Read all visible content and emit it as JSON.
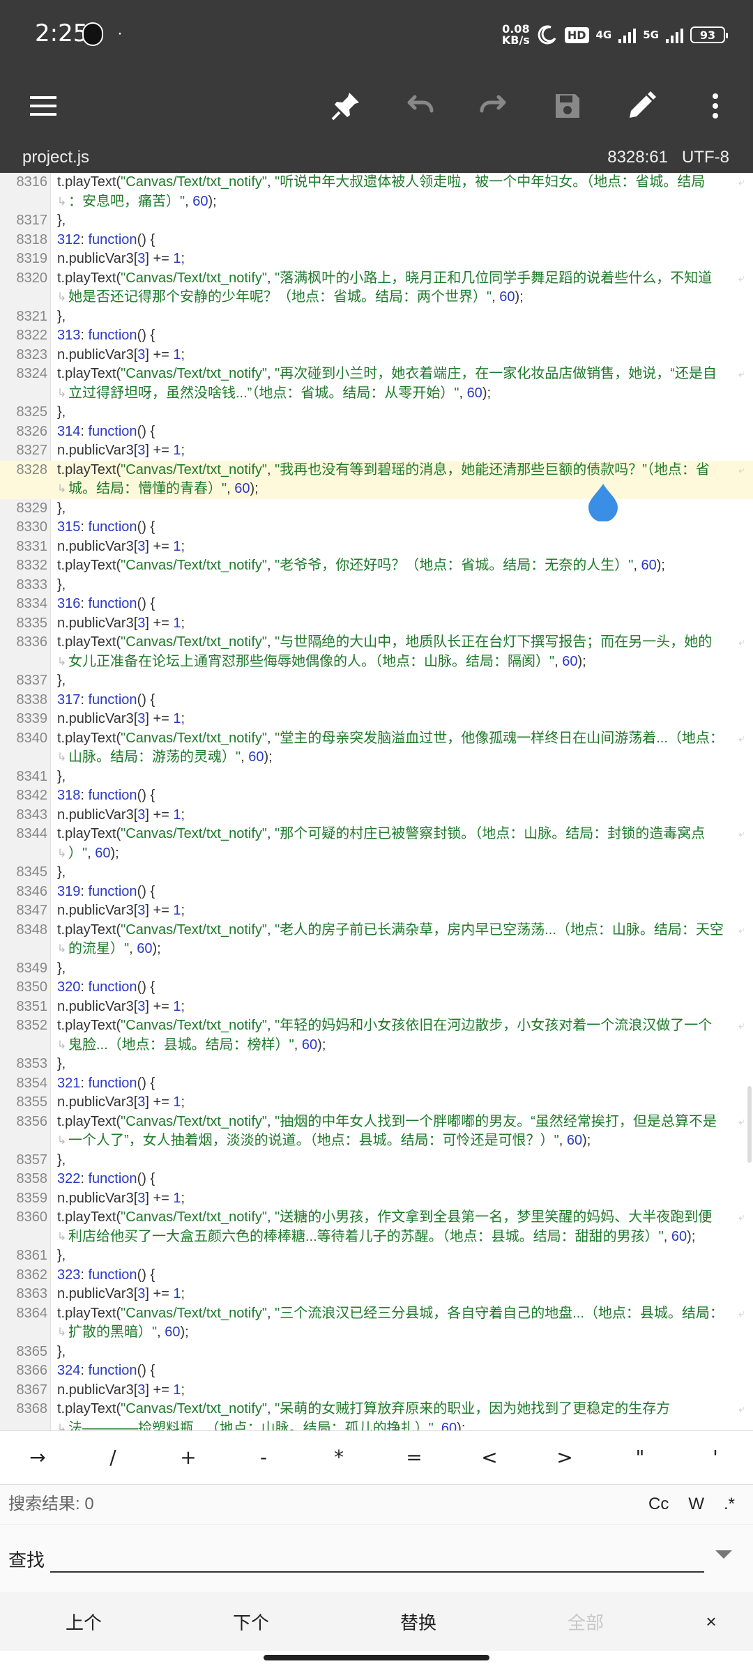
{
  "status": {
    "time": "2:25",
    "dot": "·",
    "speed_value": "0.08",
    "speed_unit": "KB/s",
    "hd": "HD",
    "net1": "4G",
    "net2": "5G",
    "battery": "93"
  },
  "toolbar": {
    "icons": [
      "menu-icon",
      "pin-icon",
      "undo-icon",
      "redo-icon",
      "save-icon",
      "edit-icon",
      "more-icon"
    ]
  },
  "file": {
    "name": "project.js",
    "position": "8328:61",
    "encoding": "UTF-8"
  },
  "lines": [
    {
      "n": "8316",
      "t": "call",
      "text": "\"听说中年大叔遗体被人领走啦，被一个中年妇女。（地点：省城。结局",
      "cont": "：安息吧，痛苦）\""
    },
    {
      "n": "8317",
      "t": "close"
    },
    {
      "n": "8318",
      "t": "fn",
      "id": "312"
    },
    {
      "n": "8319",
      "t": "inc"
    },
    {
      "n": "8320",
      "t": "call",
      "text": "\"落满枫叶的小路上，晓月正和几位同学手舞足蹈的说着些什么，不知道",
      "cont": "她是否还记得那个安静的少年呢？（地点：省城。结局：两个世界）\""
    },
    {
      "n": "8321",
      "t": "close"
    },
    {
      "n": "8322",
      "t": "fn",
      "id": "313"
    },
    {
      "n": "8323",
      "t": "inc"
    },
    {
      "n": "8324",
      "t": "call",
      "text": "\"再次碰到小兰时，她衣着端庄，在一家化妆品店做销售，她说，“还是自",
      "cont": "立过得舒坦呀，虽然没啥钱...”（地点：省城。结局：从零开始）\""
    },
    {
      "n": "8325",
      "t": "close"
    },
    {
      "n": "8326",
      "t": "fn",
      "id": "314"
    },
    {
      "n": "8327",
      "t": "inc"
    },
    {
      "n": "8328",
      "t": "call",
      "hl": true,
      "text": "\"我再也没有等到碧瑶的消息，她能还清那些巨额的债款吗？”（地点：省",
      "cont": "城。结局：懵懂的青春）\""
    },
    {
      "n": "8329",
      "t": "close"
    },
    {
      "n": "8330",
      "t": "fn",
      "id": "315"
    },
    {
      "n": "8331",
      "t": "inc"
    },
    {
      "n": "8332",
      "t": "call1",
      "text": "\"老爷爷，你还好吗？（地点：省城。结局：无奈的人生）\""
    },
    {
      "n": "8333",
      "t": "close"
    },
    {
      "n": "8334",
      "t": "fn",
      "id": "316"
    },
    {
      "n": "8335",
      "t": "inc"
    },
    {
      "n": "8336",
      "t": "call",
      "text": "\"与世隔绝的大山中，地质队长正在台灯下撰写报告；而在另一头，她的",
      "cont": "女儿正准备在论坛上通宵怼那些侮辱她偶像的人。（地点：山脉。结局：隔阂）\""
    },
    {
      "n": "8337",
      "t": "close"
    },
    {
      "n": "8338",
      "t": "fn",
      "id": "317"
    },
    {
      "n": "8339",
      "t": "inc"
    },
    {
      "n": "8340",
      "t": "call",
      "text": "\"堂主的母亲突发脑溢血过世，他像孤魂一样终日在山间游荡着...（地点：",
      "cont": "山脉。结局：游荡的灵魂）\""
    },
    {
      "n": "8341",
      "t": "close"
    },
    {
      "n": "8342",
      "t": "fn",
      "id": "318"
    },
    {
      "n": "8343",
      "t": "inc"
    },
    {
      "n": "8344",
      "t": "call",
      "text": "\"那个可疑的村庄已被警察封锁。（地点：山脉。结局：封锁的造毒窝点",
      "cont": "）\""
    },
    {
      "n": "8345",
      "t": "close"
    },
    {
      "n": "8346",
      "t": "fn",
      "id": "319"
    },
    {
      "n": "8347",
      "t": "inc"
    },
    {
      "n": "8348",
      "t": "call",
      "text": "\"老人的房子前已长满杂草，房内早已空荡荡...（地点：山脉。结局：天空",
      "cont": "的流星）\""
    },
    {
      "n": "8349",
      "t": "close"
    },
    {
      "n": "8350",
      "t": "fn",
      "id": "320"
    },
    {
      "n": "8351",
      "t": "inc"
    },
    {
      "n": "8352",
      "t": "call",
      "text": "\"年轻的妈妈和小女孩依旧在河边散步，小女孩对着一个流浪汉做了一个",
      "cont": "鬼脸...（地点：县城。结局：榜样）\""
    },
    {
      "n": "8353",
      "t": "close"
    },
    {
      "n": "8354",
      "t": "fn",
      "id": "321"
    },
    {
      "n": "8355",
      "t": "inc"
    },
    {
      "n": "8356",
      "t": "call",
      "text": "\"抽烟的中年女人找到一个胖嘟嘟的男友。“虽然经常挨打，但是总算不是",
      "cont": "一个人了”，女人抽着烟，淡淡的说道。（地点：县城。结局：可怜还是可恨？）\""
    },
    {
      "n": "8357",
      "t": "close"
    },
    {
      "n": "8358",
      "t": "fn",
      "id": "322"
    },
    {
      "n": "8359",
      "t": "inc"
    },
    {
      "n": "8360",
      "t": "call",
      "text": "\"送糖的小男孩，作文拿到全县第一名，梦里笑醒的妈妈、大半夜跑到便",
      "cont": "利店给他买了一大盒五颜六色的棒棒糖...等待着儿子的苏醒。（地点：县城。结局：甜甜的男孩）\""
    },
    {
      "n": "8361",
      "t": "close"
    },
    {
      "n": "8362",
      "t": "fn",
      "id": "323"
    },
    {
      "n": "8363",
      "t": "inc"
    },
    {
      "n": "8364",
      "t": "call",
      "text": "\"三个流浪汉已经三分县城，各自守着自己的地盘...（地点：县城。结局：",
      "cont": "扩散的黑暗）\""
    },
    {
      "n": "8365",
      "t": "close"
    },
    {
      "n": "8366",
      "t": "fn",
      "id": "324"
    },
    {
      "n": "8367",
      "t": "inc"
    },
    {
      "n": "8368",
      "t": "call",
      "text": "\"呆萌的女贼打算放弃原来的职业，因为她找到了更稳定的生存方",
      "cont": "法————捡塑料瓶...（地点：山脉。结局：孤儿的挣扎）\""
    }
  ],
  "code_tokens": {
    "call_prefix": "t.playText(",
    "call_arg": "\"Canvas/Text/txt_notify\"",
    "sep": ", ",
    "tail_num": "60",
    "tail_end": ");",
    "fn_kw": "function",
    "fn_tail": "() {",
    "inc_prefix": "n.publicVar3[",
    "inc_idx": "3",
    "inc_mid": "] += ",
    "inc_num": "1",
    "inc_end": ";",
    "close": "},"
  },
  "keys": [
    "→",
    "/",
    "+",
    "-",
    "*",
    "=",
    "<",
    ">",
    "\"",
    "'"
  ],
  "search": {
    "result": "搜索结果: 0",
    "opt_case": "Cc",
    "opt_word": "W",
    "opt_regex": ".*",
    "find_label": "查找",
    "find_value": ""
  },
  "actions": {
    "prev": "上个",
    "next": "下个",
    "replace": "替换",
    "all": "全部",
    "close": "×"
  }
}
